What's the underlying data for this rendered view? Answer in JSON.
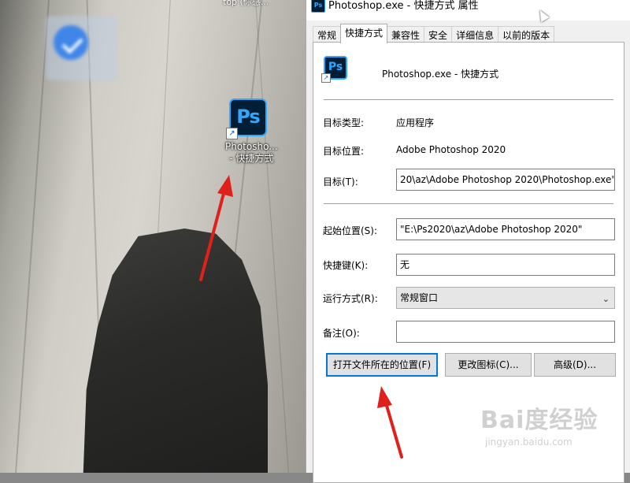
{
  "desktop": {
    "top_label": "top (你感...",
    "shortcut_label_line1": "Photosho...",
    "shortcut_label_line2": "- 快捷方式",
    "ps_icon_text": "Ps"
  },
  "dialog": {
    "title": "Photoshop.exe - 快捷方式 属性",
    "tabs": [
      "常规",
      "快捷方式",
      "兼容性",
      "安全",
      "详细信息",
      "以前的版本"
    ],
    "active_tab": "快捷方式",
    "shortcut_name": "Photoshop.exe - 快捷方式",
    "target_type_label": "目标类型:",
    "target_type_value": "应用程序",
    "target_location_label": "目标位置:",
    "target_location_value": "Adobe Photoshop 2020",
    "target_label": "目标(T):",
    "target_value": "20\\az\\Adobe Photoshop 2020\\Photoshop.exe\"",
    "start_in_label": "起始位置(S):",
    "start_in_value": "\"E:\\Ps2020\\az\\Adobe Photoshop 2020\"",
    "hotkey_label": "快捷键(K):",
    "hotkey_value": "无",
    "run_label": "运行方式(R):",
    "run_value": "常规窗口",
    "comment_label": "备注(O):",
    "comment_value": "",
    "buttons": {
      "open_location": "打开文件所在的位置(F)",
      "change_icon": "更改图标(C)...",
      "advanced": "高级(D)..."
    }
  },
  "watermark": {
    "brand": "Bai度经验",
    "url": "jingyan.baidu.com"
  },
  "colors": {
    "ps_blue": "#31a8ff",
    "ps_dark": "#001e36",
    "annotation_red": "#e0201a",
    "focus_blue": "#0078d7"
  }
}
